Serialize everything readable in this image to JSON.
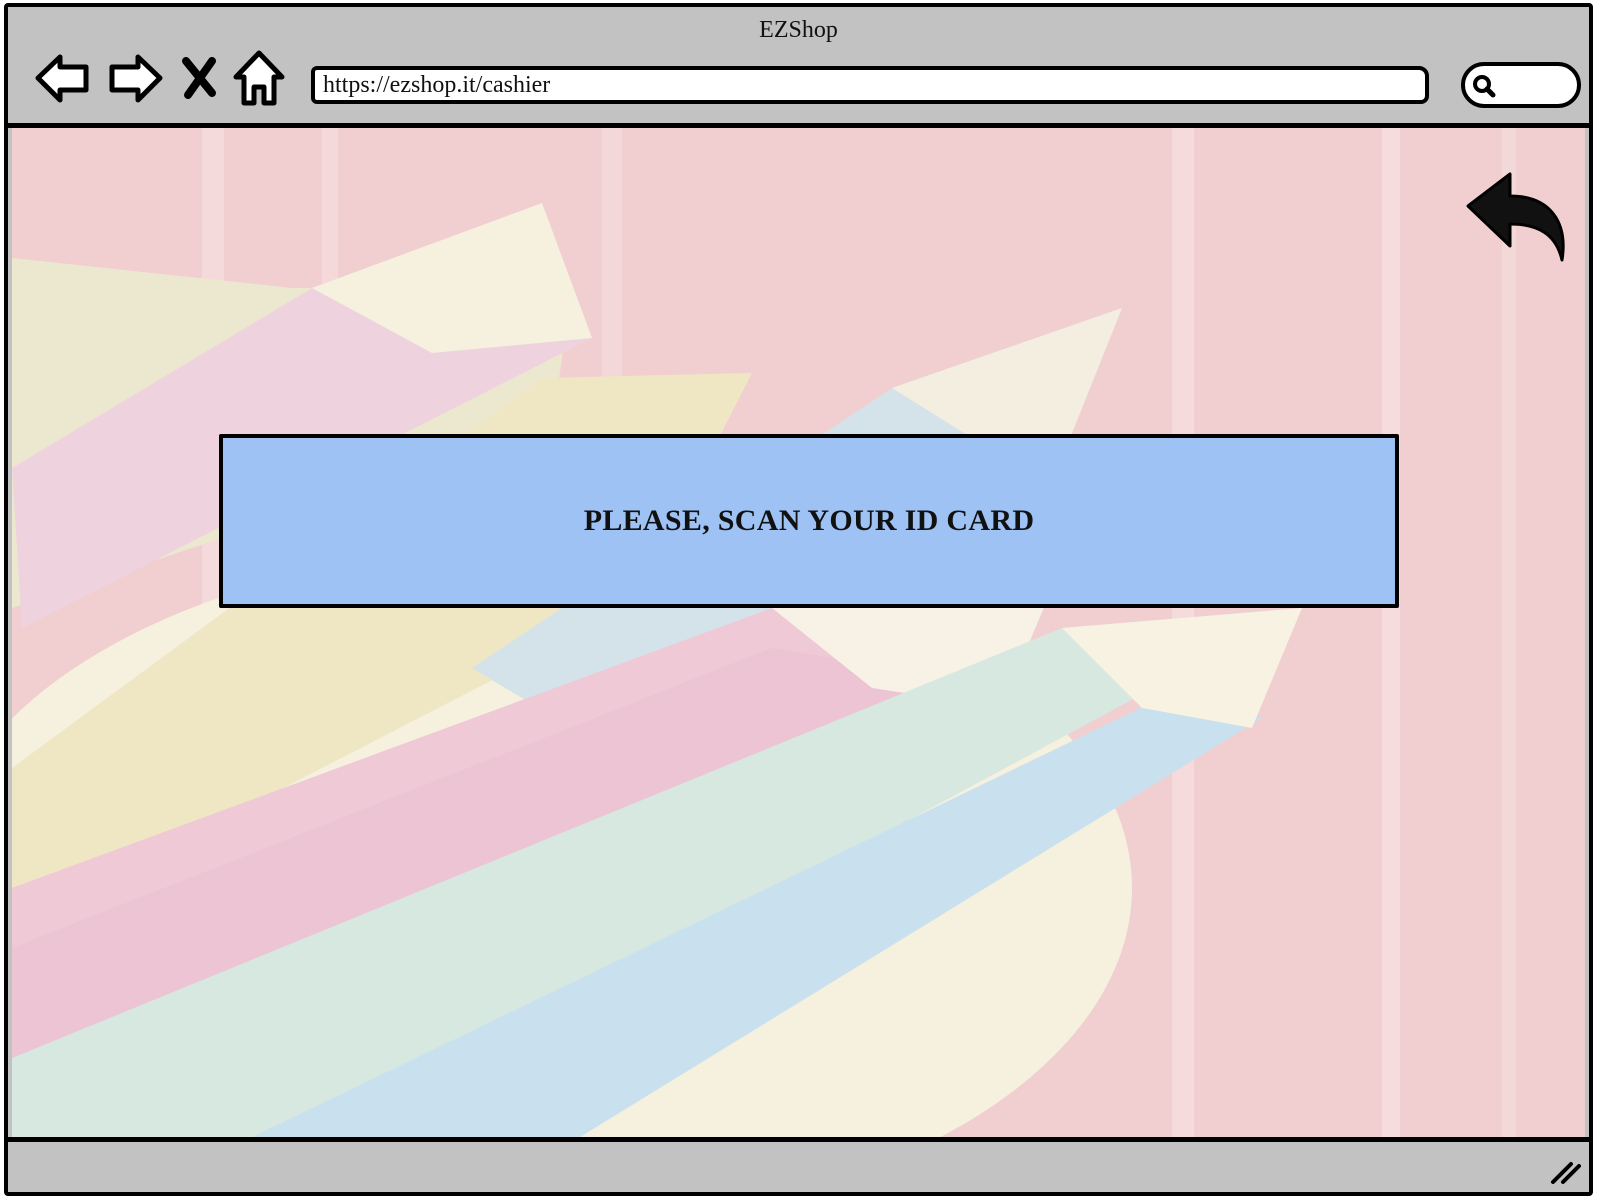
{
  "window": {
    "title": "EZShop"
  },
  "toolbar": {
    "back_icon": "arrow-left-icon",
    "forward_icon": "arrow-right-icon",
    "stop_icon": "close-icon",
    "home_icon": "home-icon",
    "url": "https://ezshop.it/cashier",
    "search_icon": "search-icon"
  },
  "main": {
    "background": "pastel-pencils-photo",
    "back_button_icon": "undo-arrow-icon",
    "prompt": "PLEASE, SCAN YOUR ID CARD"
  },
  "colors": {
    "chrome": "#c2c2c2",
    "panel": "#9fc2f5",
    "background_tint": "#f1cfd0"
  }
}
